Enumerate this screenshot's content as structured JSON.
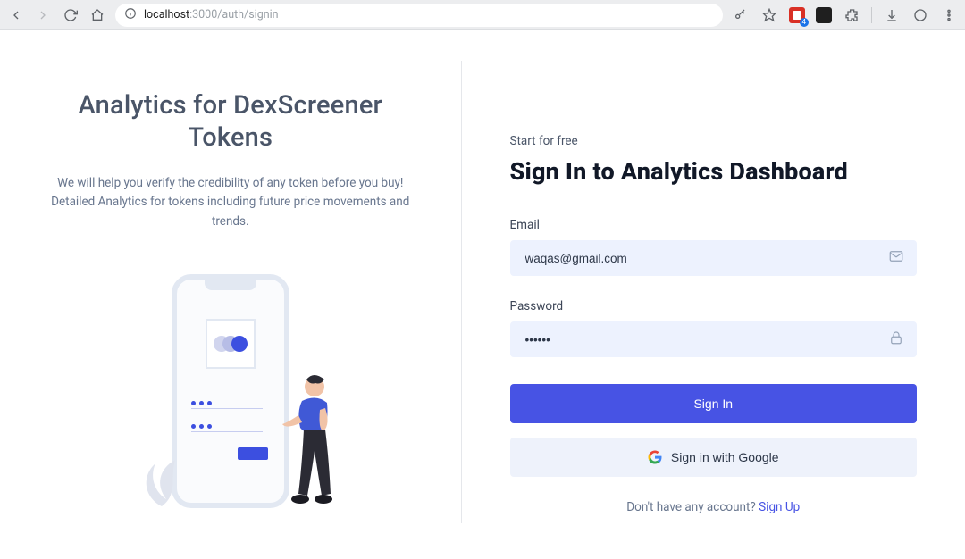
{
  "browser": {
    "url_prefix": "localhost",
    "url_rest": ":3000/auth/signin",
    "ext_badge_count": "4"
  },
  "left": {
    "title_line1": "Analytics for DexScreener",
    "title_line2": "Tokens",
    "subtitle": "We will help you verify the credibility of any token before you buy! Detailed Analytics for tokens including future price movements and trends."
  },
  "form": {
    "eyebrow": "Start for free",
    "title": "Sign In to Analytics Dashboard",
    "email_label": "Email",
    "email_value": "waqas@gmail.com",
    "password_label": "Password",
    "password_value": "••••••",
    "submit": "Sign In",
    "google": "Sign in with Google",
    "no_account_prefix": "Don't have any account?",
    "signup": "Sign Up"
  }
}
